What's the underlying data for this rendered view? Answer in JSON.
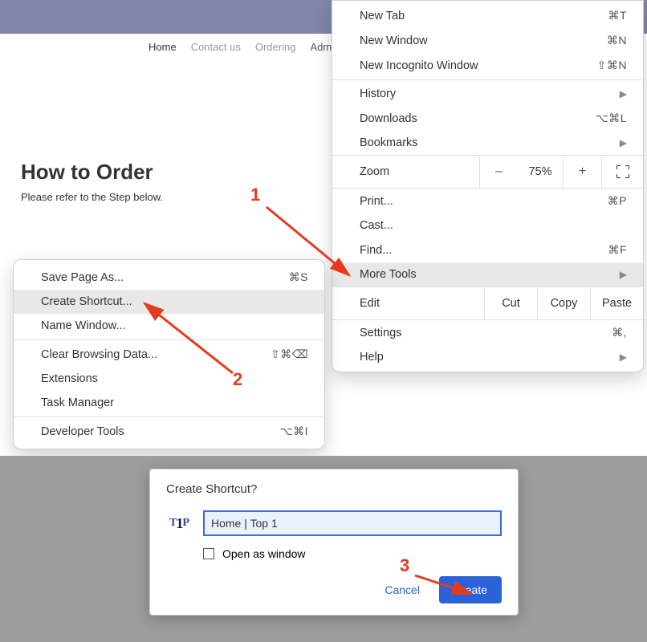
{
  "nav": {
    "items": [
      "Home",
      "Contact us",
      "Ordering",
      "Administ"
    ]
  },
  "page": {
    "title": "How to Order",
    "subtitle": "Please refer to the Step below."
  },
  "chrome_menu": {
    "new_tab": "New Tab",
    "new_tab_sc": "⌘T",
    "new_window": "New Window",
    "new_window_sc": "⌘N",
    "incognito": "New Incognito Window",
    "incognito_sc": "⇧⌘N",
    "history": "History",
    "downloads": "Downloads",
    "downloads_sc": "⌥⌘L",
    "bookmarks": "Bookmarks",
    "zoom": "Zoom",
    "zoom_minus": "–",
    "zoom_pct": "75%",
    "zoom_plus": "+",
    "print": "Print...",
    "print_sc": "⌘P",
    "cast": "Cast...",
    "find": "Find...",
    "find_sc": "⌘F",
    "more_tools": "More Tools",
    "edit": "Edit",
    "cut": "Cut",
    "copy": "Copy",
    "paste": "Paste",
    "settings": "Settings",
    "settings_sc": "⌘,",
    "help": "Help"
  },
  "submenu": {
    "save_as": "Save Page As...",
    "save_as_sc": "⌘S",
    "create_shortcut": "Create Shortcut...",
    "name_window": "Name Window...",
    "clear_data": "Clear Browsing Data...",
    "clear_data_sc": "⇧⌘⌫",
    "extensions": "Extensions",
    "task_manager": "Task Manager",
    "dev_tools": "Developer Tools",
    "dev_tools_sc": "⌥⌘I"
  },
  "annotations": {
    "n1": "1",
    "n2": "2",
    "n3": "3"
  },
  "dialog": {
    "title": "Create Shortcut?",
    "input_value": "Home | Top 1",
    "open_window": "Open as window",
    "cancel": "Cancel",
    "create": "Create",
    "icon_left": "T",
    "icon_mid": "1",
    "icon_right": "P"
  }
}
